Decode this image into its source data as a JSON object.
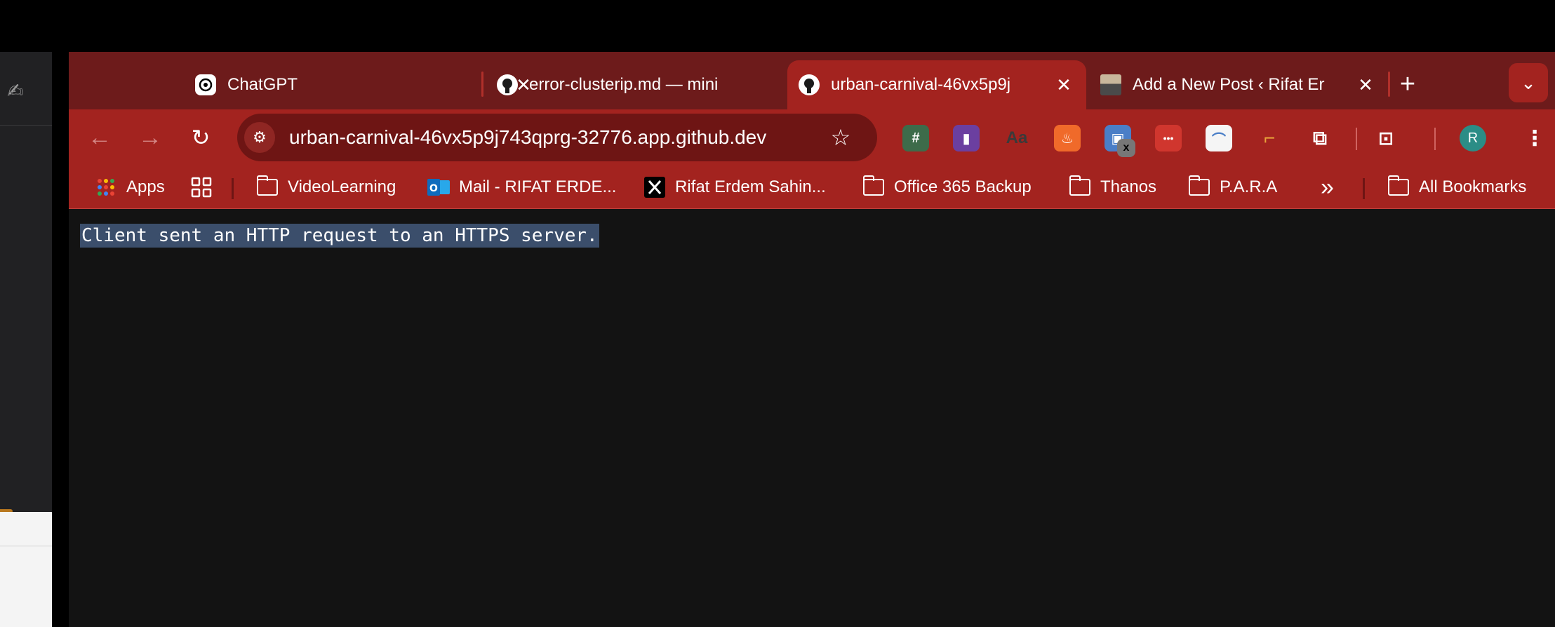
{
  "tabs": [
    {
      "title": "ChatGPT",
      "favicon": "openai-icon",
      "active": false
    },
    {
      "title": "error-clusterip.md — mini",
      "favicon": "github-icon",
      "active": false
    },
    {
      "title": "urban-carnival-46vx5p9j",
      "favicon": "github-icon",
      "active": true
    },
    {
      "title": "Add a New Post ‹ Rifat Er",
      "favicon": "profile-photo-icon",
      "active": false
    }
  ],
  "tab_close_glyph": "✕",
  "new_tab_glyph": "+",
  "address_bar": {
    "url": "urban-carnival-46vx5p9j743qprg-32776.app.github.dev"
  },
  "toolbar": {
    "avatar_letter": "R"
  },
  "bookmarks": {
    "apps": "Apps",
    "items": [
      {
        "label": "VideoLearning",
        "icon": "folder-icon"
      },
      {
        "label": "Mail - RIFAT ERDE...",
        "icon": "outlook-icon"
      },
      {
        "label": "Rifat Erdem Sahin...",
        "icon": "x-logo-icon"
      },
      {
        "label": "Office 365 Backup",
        "icon": "folder-icon"
      },
      {
        "label": "Thanos",
        "icon": "folder-icon"
      },
      {
        "label": "P.A.R.A",
        "icon": "folder-icon"
      }
    ],
    "overflow_glyph": "»",
    "all_bookmarks": "All Bookmarks"
  },
  "page": {
    "message": "Client sent an HTTP request to an HTTPS server."
  },
  "colors": {
    "tab_strip": "#6d1b1b",
    "active_tab": "#a3231f",
    "omnibox": "#6e1514",
    "page_bg": "#131313",
    "selection": "#3b4e6b"
  }
}
